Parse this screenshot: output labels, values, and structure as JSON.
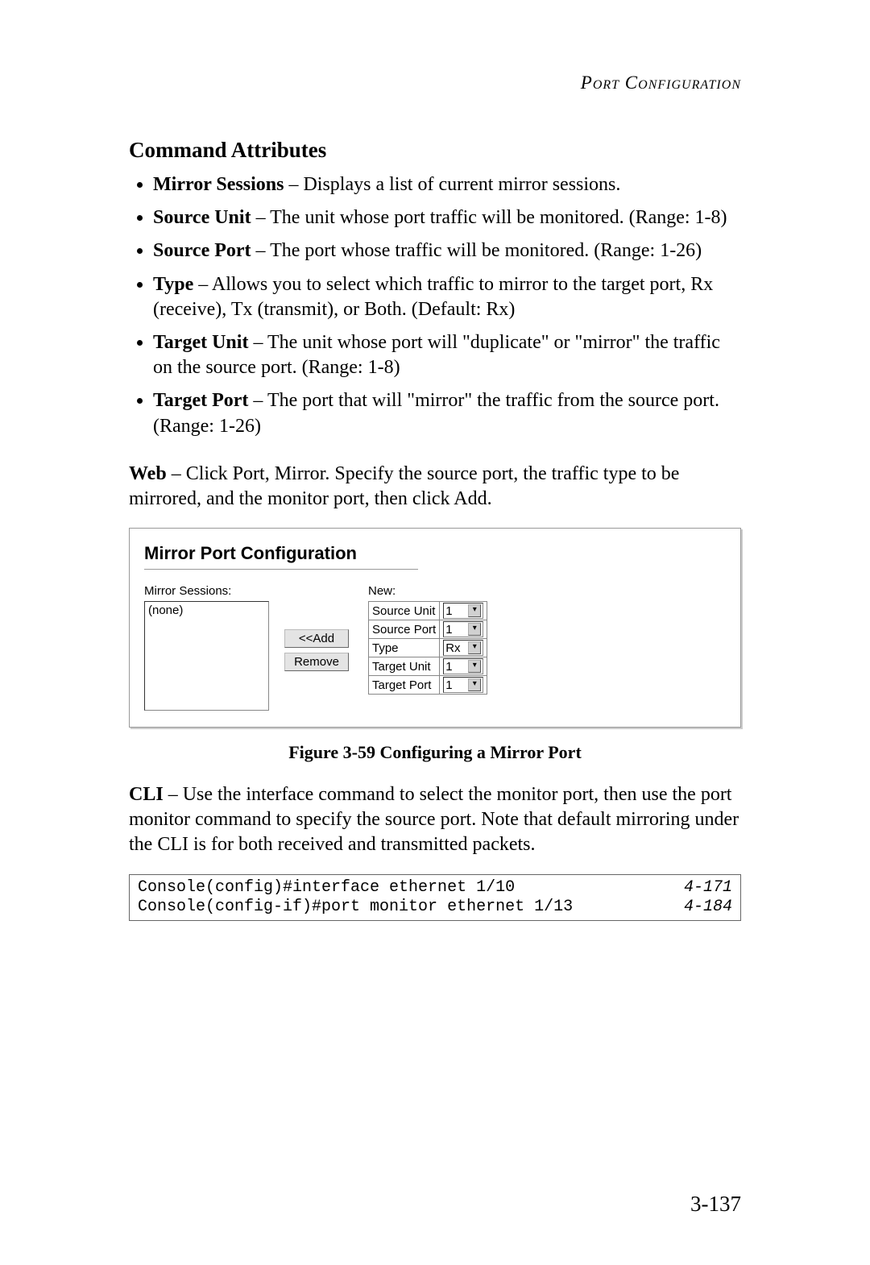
{
  "running_head": "Port Configuration",
  "section_title": "Command Attributes",
  "attrs": [
    {
      "term": "Mirror Sessions",
      "desc": " – Displays a list of current mirror sessions."
    },
    {
      "term": "Source Unit",
      "desc": " – The unit whose port traffic will be monitored. (Range: 1-8)"
    },
    {
      "term": "Source Port",
      "desc": " – The port whose traffic will be monitored. (Range: 1-26)"
    },
    {
      "term": "Type",
      "desc": " – Allows you to select which traffic to mirror to the target port, Rx (receive), Tx (transmit), or Both. (Default: Rx)"
    },
    {
      "term": "Target Unit",
      "desc": " – The unit whose port will \"duplicate\" or \"mirror\" the traffic on the source port. (Range: 1-8)"
    },
    {
      "term": "Target Port",
      "desc": " – The port that will \"mirror\" the traffic from the source port. (Range: 1-26)"
    }
  ],
  "web_label": "Web",
  "web_text": " – Click Port, Mirror. Specify the source port, the traffic type to be mirrored, and the monitor port, then click Add.",
  "fig": {
    "title": "Mirror Port Configuration",
    "sessions_label": "Mirror Sessions:",
    "sessions_value": "(none)",
    "add_btn": "<<Add",
    "remove_btn": "Remove",
    "new_label": "New:",
    "rows": [
      {
        "label": "Source Unit",
        "value": "1"
      },
      {
        "label": "Source Port",
        "value": "1"
      },
      {
        "label": "Type",
        "value": "Rx"
      },
      {
        "label": "Target Unit",
        "value": "1"
      },
      {
        "label": "Target Port",
        "value": "1"
      }
    ]
  },
  "figure_caption": "Figure 3-59  Configuring a Mirror Port",
  "cli_label": "CLI",
  "cli_text": " – Use the interface command to select the monitor port, then use the port monitor command to specify the source port. Note that default mirroring under the CLI is for both received and transmitted packets.",
  "cli": [
    {
      "cmd": "Console(config)#interface ethernet 1/10",
      "ref": "4-171"
    },
    {
      "cmd": "Console(config-if)#port monitor ethernet 1/13",
      "ref": "4-184"
    }
  ],
  "page_number": "3-137"
}
